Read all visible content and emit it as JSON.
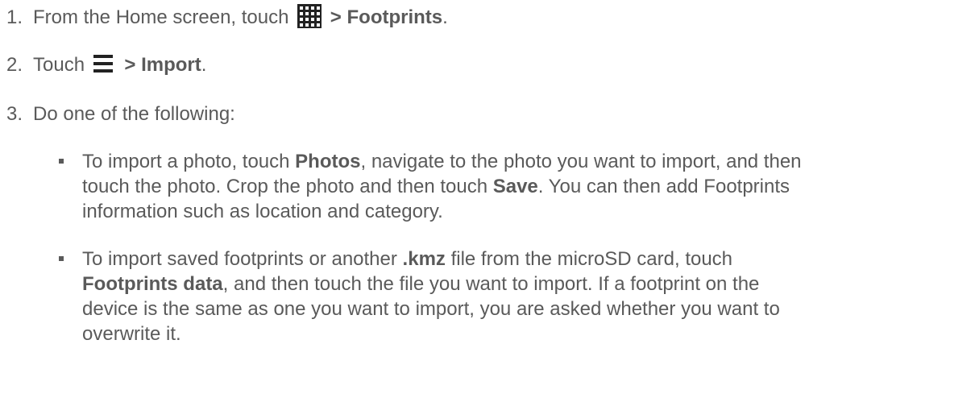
{
  "steps": [
    {
      "number": "1.",
      "prefix": "From the Home screen, touch ",
      "icon": "apps-grid-icon",
      "bold": " > Footprints",
      "suffix": "."
    },
    {
      "number": "2.",
      "prefix": "Touch ",
      "icon": "menu-icon",
      "bold": " > Import",
      "suffix": "."
    },
    {
      "number": "3.",
      "text": "Do one of the following:"
    }
  ],
  "bullets": [
    {
      "lines": [
        [
          {
            "t": "To import a photo, touch ",
            "b": false
          },
          {
            "t": "Photos",
            "b": true
          },
          {
            "t": ", navigate to the photo you want to import, and then",
            "b": false
          }
        ],
        [
          {
            "t": "touch the photo. Crop the photo and then touch ",
            "b": false
          },
          {
            "t": "Save",
            "b": true
          },
          {
            "t": ". You can then add Footprints",
            "b": false
          }
        ],
        [
          {
            "t": "information such as location and category.",
            "b": false
          }
        ]
      ]
    },
    {
      "lines": [
        [
          {
            "t": "To import saved footprints or another ",
            "b": false
          },
          {
            "t": ".kmz",
            "b": true
          },
          {
            "t": " file from the microSD card, touch",
            "b": false
          }
        ],
        [
          {
            "t": "Footprints data",
            "b": true
          },
          {
            "t": ", and then touch the file you want to import. If a footprint on the",
            "b": false
          }
        ],
        [
          {
            "t": "device is the same as one you want to import, you are asked whether you want to",
            "b": false
          }
        ],
        [
          {
            "t": "overwrite it.",
            "b": false
          }
        ]
      ]
    }
  ],
  "colors": {
    "text": "#5a5a5a",
    "icon_dark": "#222222"
  }
}
